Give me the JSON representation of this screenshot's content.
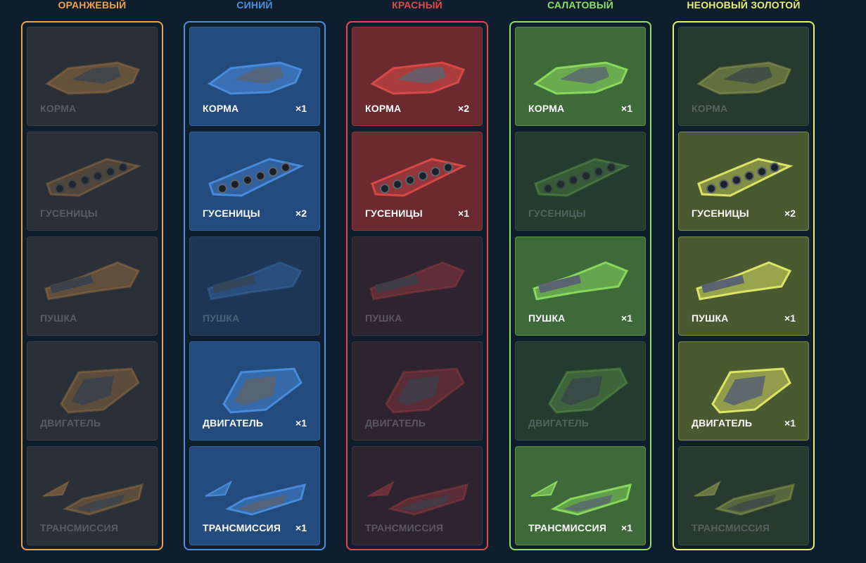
{
  "columns": [
    {
      "title": "ОРАНЖЕВЫЙ",
      "accent": "#f0a24a",
      "card_on": "#3a4350",
      "card_off": "#2a3038",
      "items": [
        {
          "label": "КОРМА",
          "count": "",
          "owned": false
        },
        {
          "label": "ГУСЕНИЦЫ",
          "count": "",
          "owned": false
        },
        {
          "label": "ПУШКА",
          "count": "",
          "owned": false
        },
        {
          "label": "ДВИГАТЕЛЬ",
          "count": "",
          "owned": false
        },
        {
          "label": "ТРАНСМИССИЯ",
          "count": "",
          "owned": false
        }
      ]
    },
    {
      "title": "СИНИЙ",
      "accent": "#4a90e0",
      "card_on": "#244b7d",
      "card_off": "#1d3656",
      "items": [
        {
          "label": "КОРМА",
          "count": "×1",
          "owned": true
        },
        {
          "label": "ГУСЕНИЦЫ",
          "count": "×2",
          "owned": true
        },
        {
          "label": "ПУШКА",
          "count": "",
          "owned": false
        },
        {
          "label": "ДВИГАТЕЛЬ",
          "count": "×1",
          "owned": true
        },
        {
          "label": "ТРАНСМИССИЯ",
          "count": "×1",
          "owned": true
        }
      ]
    },
    {
      "title": "КРАСНЫЙ",
      "accent": "#e04a4a",
      "card_on": "#6a2a30",
      "card_off": "#2e2430",
      "items": [
        {
          "label": "КОРМА",
          "count": "×2",
          "owned": true
        },
        {
          "label": "ГУСЕНИЦЫ",
          "count": "×1",
          "owned": true
        },
        {
          "label": "ПУШКА",
          "count": "",
          "owned": false
        },
        {
          "label": "ДВИГАТЕЛЬ",
          "count": "",
          "owned": false
        },
        {
          "label": "ТРАНСМИССИЯ",
          "count": "",
          "owned": false
        }
      ]
    },
    {
      "title": "САЛАТОВЫЙ",
      "accent": "#8ee060",
      "card_on": "#3e6a3a",
      "card_off": "#233c2e",
      "items": [
        {
          "label": "КОРМА",
          "count": "×1",
          "owned": true
        },
        {
          "label": "ГУСЕНИЦЫ",
          "count": "",
          "owned": false
        },
        {
          "label": "ПУШКА",
          "count": "×1",
          "owned": true
        },
        {
          "label": "ДВИГАТЕЛЬ",
          "count": "",
          "owned": false
        },
        {
          "label": "ТРАНСМИССИЯ",
          "count": "×1",
          "owned": true
        }
      ]
    },
    {
      "title": "НЕОНОВЫЙ ЗОЛОТОЙ",
      "accent": "#e8f06a",
      "card_on": "#4a5a30",
      "card_off": "#283a2e",
      "items": [
        {
          "label": "КОРМА",
          "count": "",
          "owned": false
        },
        {
          "label": "ГУСЕНИЦЫ",
          "count": "×2",
          "owned": true
        },
        {
          "label": "ПУШКА",
          "count": "×1",
          "owned": true
        },
        {
          "label": "ДВИГАТЕЛЬ",
          "count": "×1",
          "owned": true
        },
        {
          "label": "ТРАНСМИССИЯ",
          "count": "",
          "owned": false
        }
      ]
    }
  ],
  "part_icons": [
    "hull-icon",
    "tracks-icon",
    "cannon-icon",
    "engine-icon",
    "transmission-icon"
  ]
}
